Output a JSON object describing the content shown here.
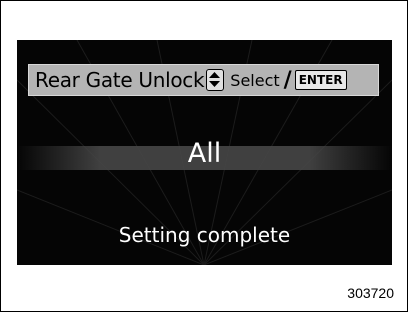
{
  "display": {
    "title": "Rear Gate Unlock",
    "select_label": "Select",
    "separator": "/",
    "enter_label": "ENTER",
    "value": "All",
    "status": "Setting complete"
  },
  "figure_number": "303720",
  "icons": {
    "selector": "up-down-arrow-icon",
    "enter": "enter-key-icon"
  },
  "colors": {
    "screen_background": "#050505",
    "header_background": "#b4b4b4",
    "screen_text": "#ffffff"
  }
}
